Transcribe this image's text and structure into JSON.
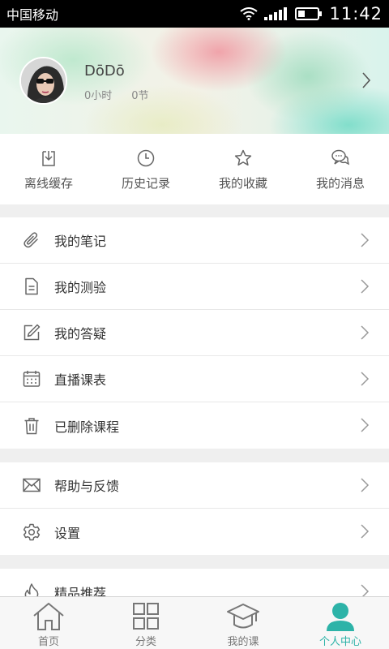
{
  "status_bar": {
    "carrier": "中国移动",
    "time": "11:42"
  },
  "profile": {
    "username": "DōDō",
    "hours": "0小时",
    "sections": "0节"
  },
  "quick_actions": [
    {
      "label": "离线缓存",
      "icon": "download-icon"
    },
    {
      "label": "历史记录",
      "icon": "clock-icon"
    },
    {
      "label": "我的收藏",
      "icon": "star-icon"
    },
    {
      "label": "我的消息",
      "icon": "message-icon"
    }
  ],
  "menu_group_1": [
    {
      "label": "我的笔记",
      "icon": "paperclip-icon"
    },
    {
      "label": "我的测验",
      "icon": "document-icon"
    },
    {
      "label": "我的答疑",
      "icon": "edit-icon"
    },
    {
      "label": "直播课表",
      "icon": "calendar-icon"
    },
    {
      "label": "已删除课程",
      "icon": "trash-icon"
    }
  ],
  "menu_group_2": [
    {
      "label": "帮助与反馈",
      "icon": "mail-icon"
    },
    {
      "label": "设置",
      "icon": "gear-icon"
    }
  ],
  "menu_group_3": [
    {
      "label": "精品推荐",
      "icon": "flame-icon"
    }
  ],
  "tabbar": {
    "tabs": [
      {
        "label": "首页",
        "icon": "home-icon"
      },
      {
        "label": "分类",
        "icon": "grid-icon"
      },
      {
        "label": "我的课",
        "icon": "graduation-cap-icon"
      },
      {
        "label": "个人中心",
        "icon": "person-icon"
      }
    ],
    "active_index": 3
  },
  "colors": {
    "accent": "#2db3a8",
    "icon_gray": "#666666"
  }
}
